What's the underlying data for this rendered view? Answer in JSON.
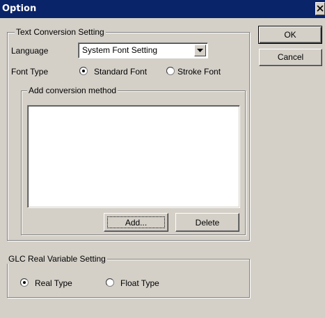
{
  "window": {
    "title": "Option"
  },
  "buttons": {
    "ok": "OK",
    "cancel": "Cancel",
    "add": "Add...",
    "delete": "Delete"
  },
  "text_conversion": {
    "group_label": "Text Conversion Setting",
    "language_label": "Language",
    "language_value": "System Font Setting",
    "font_type_label": "Font Type",
    "font_options": [
      {
        "label": "Standard Font",
        "selected": true
      },
      {
        "label": "Stroke Font",
        "selected": false
      }
    ],
    "add_conversion_label": "Add conversion method"
  },
  "glc": {
    "group_label": "GLC Real Variable Setting",
    "options": [
      {
        "label": "Real Type",
        "selected": true
      },
      {
        "label": "Float Type",
        "selected": false
      }
    ]
  },
  "icons": {
    "close": "close-icon",
    "dropdown": "chevron-down-icon"
  },
  "colors": {
    "titlebar": "#0a246a",
    "face": "#d4d0c8",
    "title_text": "#ffffff"
  }
}
